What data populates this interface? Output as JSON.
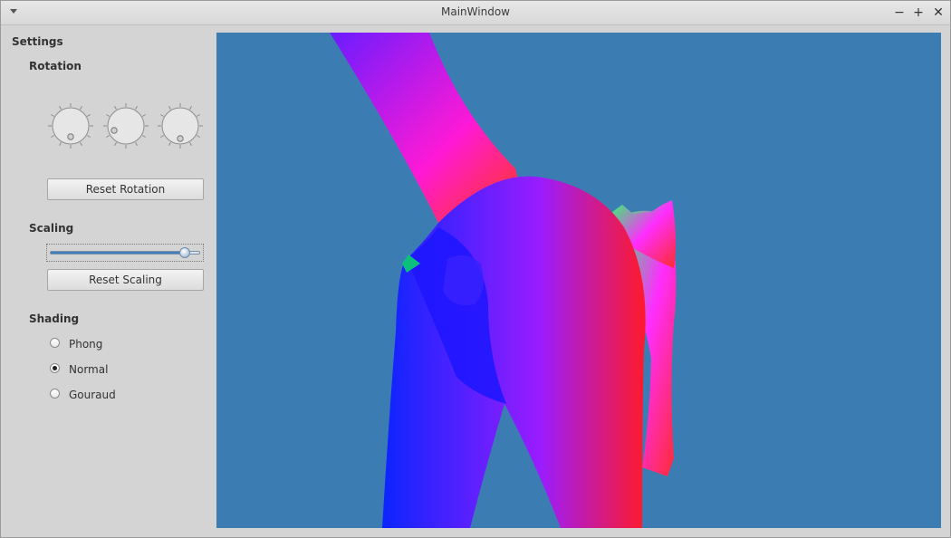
{
  "window": {
    "title": "MainWindow"
  },
  "settings": {
    "heading": "Settings",
    "rotation": {
      "label": "Rotation",
      "dials": [
        {
          "name": "x"
        },
        {
          "name": "y"
        },
        {
          "name": "z"
        }
      ],
      "reset_label": "Reset Rotation"
    },
    "scaling": {
      "label": "Scaling",
      "slider_value": 0.9,
      "reset_label": "Reset Scaling"
    },
    "shading": {
      "label": "Shading",
      "options": [
        {
          "label": "Phong",
          "checked": false
        },
        {
          "label": "Normal",
          "checked": true
        },
        {
          "label": "Gouraud",
          "checked": false
        }
      ]
    }
  },
  "viewport": {
    "background": "#3b7db3"
  },
  "icons": {
    "menu": "chevron-down-icon",
    "minimize": "minus-icon",
    "maximize": "plus-icon",
    "close": "close-icon"
  }
}
